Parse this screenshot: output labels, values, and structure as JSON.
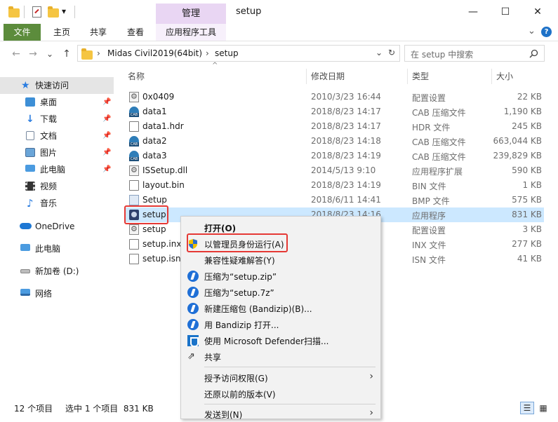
{
  "window": {
    "title": "setup",
    "manage_tab": "管理",
    "controls": {
      "minimize": "—",
      "maximize": "☐",
      "close": "✕"
    },
    "qat_dropdown": "▾"
  },
  "ribbon": {
    "tabs": [
      "文件",
      "主页",
      "共享",
      "查看"
    ],
    "app_tools": "应用程序工具",
    "collapse": "⌄",
    "help": "?"
  },
  "address": {
    "path": [
      "Midas Civil2019(64bit)",
      "setup"
    ],
    "separator": "›",
    "dropdown": "⌄",
    "refresh": "↻",
    "back": "←",
    "forward": "→",
    "recent": "⌄",
    "up": "↑"
  },
  "search": {
    "placeholder": "在 setup 中搜索",
    "icon": "search-icon"
  },
  "nav": {
    "items": [
      {
        "label": "快速访问",
        "icon": "star-icon",
        "pinned": false
      },
      {
        "label": "桌面",
        "icon": "desktop-icon",
        "pinned": true
      },
      {
        "label": "下载",
        "icon": "download-icon",
        "pinned": true
      },
      {
        "label": "文档",
        "icon": "documents-icon",
        "pinned": true
      },
      {
        "label": "图片",
        "icon": "pictures-icon",
        "pinned": true
      },
      {
        "label": "此电脑",
        "icon": "computer-icon",
        "pinned": true
      },
      {
        "label": "视频",
        "icon": "video-icon",
        "pinned": false
      },
      {
        "label": "音乐",
        "icon": "music-icon",
        "pinned": false
      },
      {
        "label": "OneDrive",
        "icon": "cloud-icon",
        "pinned": false
      },
      {
        "label": "此电脑",
        "icon": "computer-icon",
        "pinned": false
      },
      {
        "label": "新加卷 (D:)",
        "icon": "drive-icon",
        "pinned": false
      },
      {
        "label": "网络",
        "icon": "network-icon",
        "pinned": false
      }
    ],
    "pin_glyph": "📌"
  },
  "columns": {
    "name": "名称",
    "date": "修改日期",
    "type": "类型",
    "size": "大小",
    "sort_glyph": "^"
  },
  "files": [
    {
      "name": "0x0409",
      "date": "2010/3/23 16:44",
      "type": "配置设置",
      "size": "22 KB",
      "icon": "gear"
    },
    {
      "name": "data1",
      "date": "2018/8/23 14:17",
      "type": "CAB 压缩文件",
      "size": "1,190 KB",
      "icon": "cab"
    },
    {
      "name": "data1.hdr",
      "date": "2018/8/23 14:17",
      "type": "HDR 文件",
      "size": "245 KB",
      "icon": "doc"
    },
    {
      "name": "data2",
      "date": "2018/8/23 14:18",
      "type": "CAB 压缩文件",
      "size": "663,044 KB",
      "icon": "cab"
    },
    {
      "name": "data3",
      "date": "2018/8/23 14:19",
      "type": "CAB 压缩文件",
      "size": "239,829 KB",
      "icon": "cab"
    },
    {
      "name": "ISSetup.dll",
      "date": "2014/5/13 9:10",
      "type": "应用程序扩展",
      "size": "590 KB",
      "icon": "gear"
    },
    {
      "name": "layout.bin",
      "date": "2018/8/23 14:19",
      "type": "BIN 文件",
      "size": "1 KB",
      "icon": "doc"
    },
    {
      "name": "Setup",
      "date": "2018/6/11 14:41",
      "type": "BMP 文件",
      "size": "575 KB",
      "icon": "exe"
    },
    {
      "name": "setup",
      "date": "2018/8/23 14:16",
      "type": "应用程序",
      "size": "831 KB",
      "icon": "setup"
    },
    {
      "name": "setup",
      "date": "",
      "type": "配置设置",
      "size": "3 KB",
      "icon": "gear"
    },
    {
      "name": "setup.inx",
      "date": "",
      "type": "INX 文件",
      "size": "277 KB",
      "icon": "doc"
    },
    {
      "name": "setup.isn",
      "date": "",
      "type": "ISN 文件",
      "size": "41 KB",
      "icon": "doc"
    }
  ],
  "context_menu": {
    "items": [
      {
        "label": "打开(O)",
        "bold": true,
        "icon": ""
      },
      {
        "label": "以管理员身份运行(A)",
        "icon": "shield-icon"
      },
      {
        "label": "兼容性疑难解答(Y)",
        "icon": ""
      },
      {
        "label": "压缩为“setup.zip”",
        "icon": "bandizip-icon"
      },
      {
        "label": "压缩为“setup.7z”",
        "icon": "bandizip-icon"
      },
      {
        "label": "新建压缩包 (Bandizip)(B)...",
        "icon": "bandizip-icon"
      },
      {
        "label": "用 Bandizip 打开...",
        "icon": "bandizip-icon"
      },
      {
        "label": "使用 Microsoft Defender扫描...",
        "icon": "defender-icon"
      },
      {
        "label": "共享",
        "icon": "share-icon"
      },
      {
        "label": "授予访问权限(G)",
        "icon": "",
        "submenu": true
      },
      {
        "label": "还原以前的版本(V)",
        "icon": ""
      },
      {
        "label": "发送到(N)",
        "icon": "",
        "submenu": true
      }
    ],
    "submenu_glyph": "›"
  },
  "status": {
    "count": "12 个项目",
    "selection": "选中 1 个项目  831 KB"
  },
  "colors": {
    "file_tab": "#5c8c3c",
    "manage_tab": "#e9d6f3",
    "selection": "#cce8ff",
    "highlight_border": "#e53935"
  }
}
